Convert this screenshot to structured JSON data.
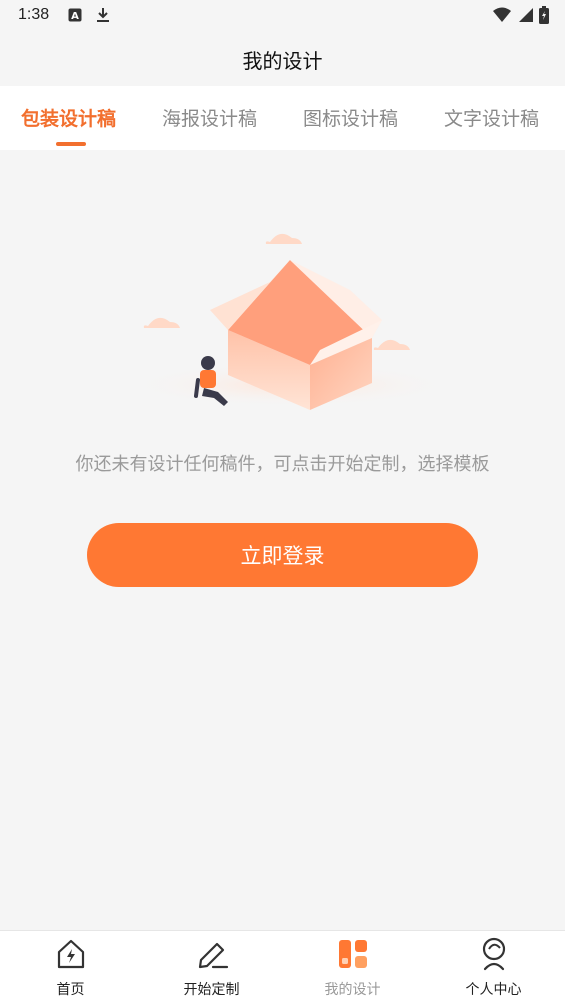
{
  "status_bar": {
    "time": "1:38"
  },
  "header": {
    "title": "我的设计"
  },
  "tabs": [
    {
      "label": "包装设计稿",
      "active": true
    },
    {
      "label": "海报设计稿",
      "active": false
    },
    {
      "label": "图标设计稿",
      "active": false
    },
    {
      "label": "文字设计稿",
      "active": false
    }
  ],
  "empty_state": {
    "message": "你还未有设计任何稿件，可点击开始定制，选择模板"
  },
  "login_button": {
    "label": "立即登录"
  },
  "bottom_nav": [
    {
      "label": "首页",
      "icon": "home-icon",
      "active": false
    },
    {
      "label": "开始定制",
      "icon": "pencil-icon",
      "active": false
    },
    {
      "label": "我的设计",
      "icon": "design-grid-icon",
      "active": true
    },
    {
      "label": "个人中心",
      "icon": "user-icon",
      "active": false
    }
  ],
  "colors": {
    "accent": "#ff7833",
    "tab_active": "#f26f2e",
    "background": "#f5f5f5"
  }
}
